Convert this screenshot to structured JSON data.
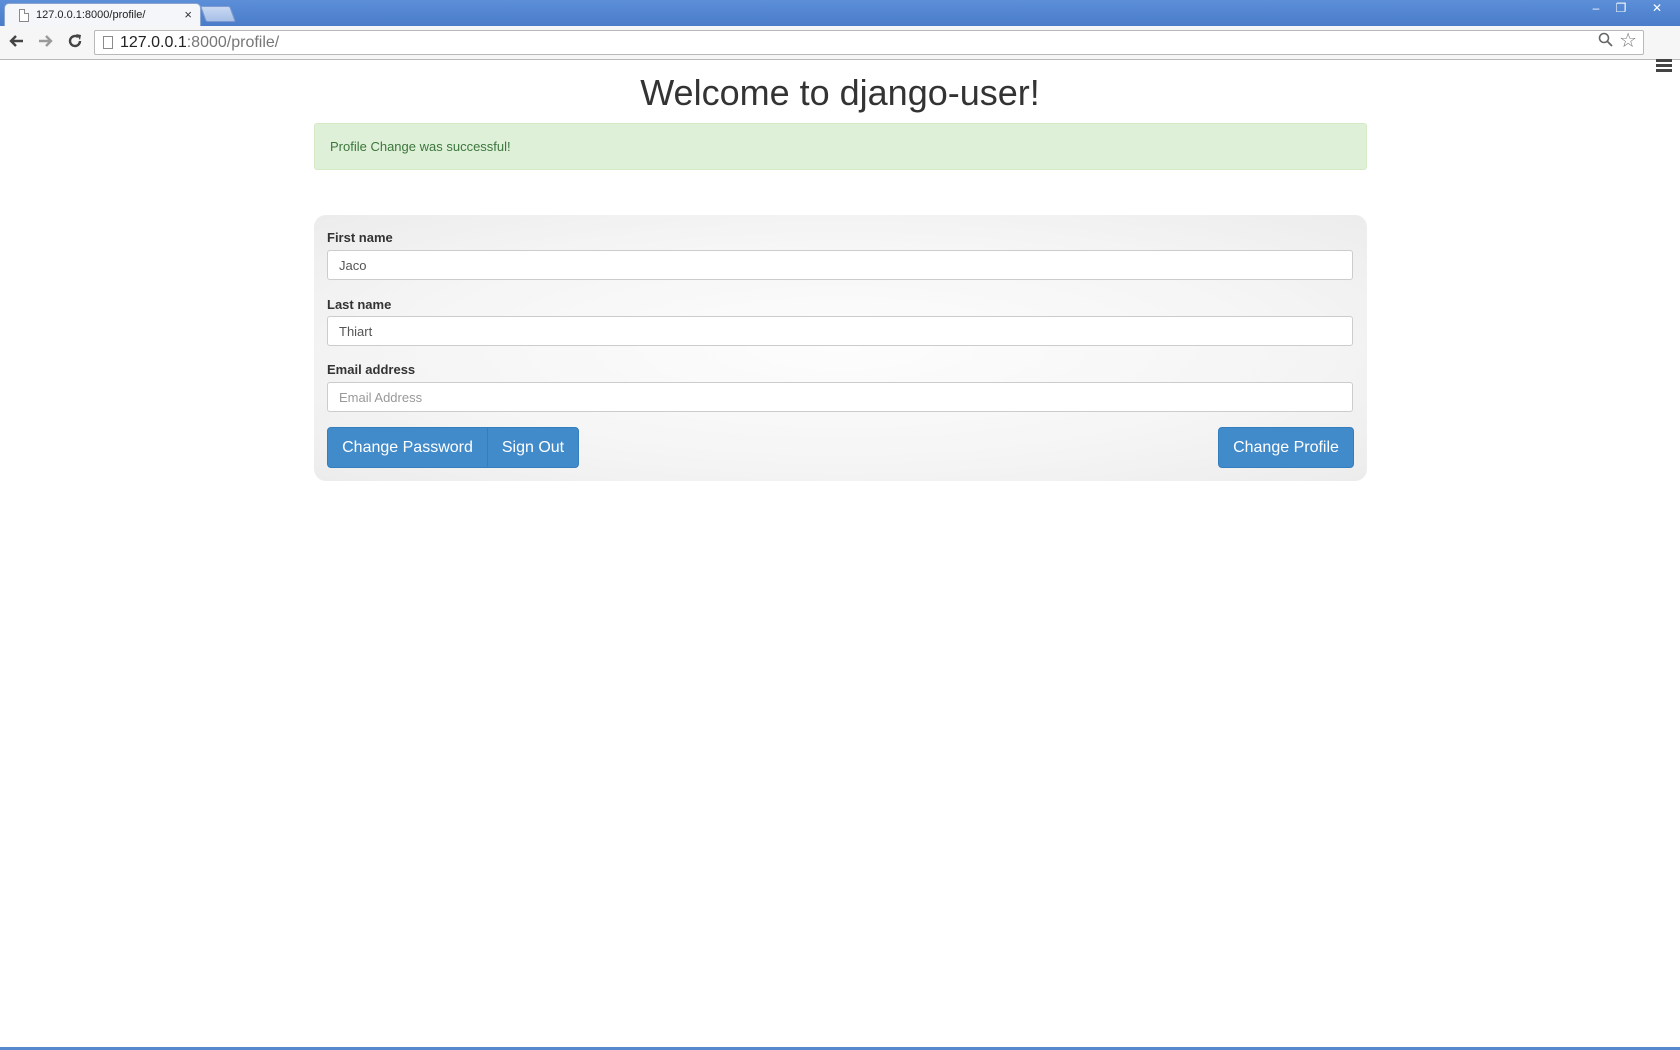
{
  "browser": {
    "tab_title": "127.0.0.1:8000/profile/",
    "tab_close": "×",
    "url_host": "127.0.0.1",
    "url_path": ":8000/profile/",
    "window_controls": {
      "minimize": "–",
      "maximize": "❐",
      "close": "✕"
    },
    "icons": {
      "back": "arrow-left-icon",
      "forward": "arrow-right-icon",
      "reload": "reload-icon",
      "search": "search-icon",
      "bookmark": "star-icon",
      "menu": "hamburger-menu-icon"
    }
  },
  "page": {
    "title": "Welcome to django-user!",
    "alert": "Profile Change was successful!",
    "form": {
      "first_name_label": "First name",
      "first_name_value": "Jaco",
      "last_name_label": "Last name",
      "last_name_value": "Thiart",
      "email_label": "Email address",
      "email_value": "",
      "email_placeholder": "Email Address"
    },
    "buttons": {
      "change_password": "Change Password",
      "sign_out": "Sign Out",
      "change_profile": "Change Profile"
    }
  },
  "colors": {
    "primary_button": "#428bca",
    "alert_background": "#dff0d8",
    "alert_text": "#3c763d",
    "titlebar": "#4a7cc9"
  }
}
